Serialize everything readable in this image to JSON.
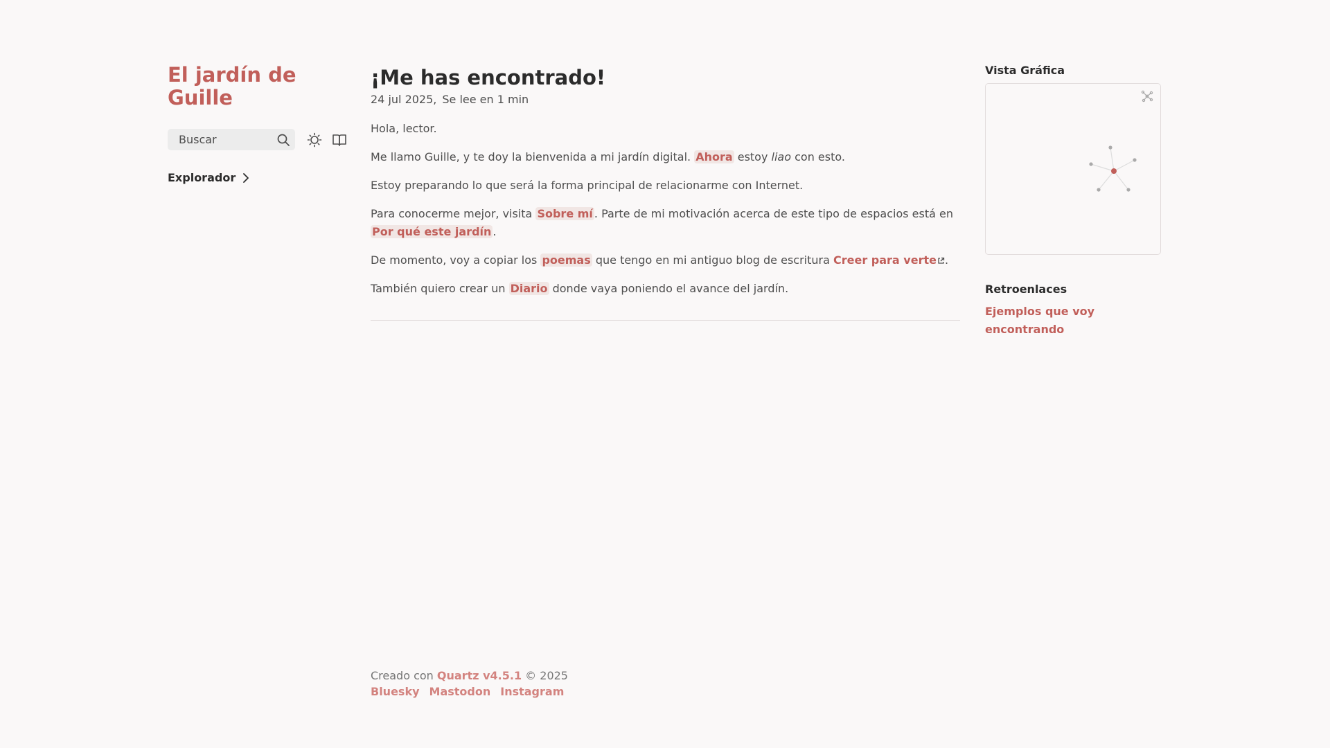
{
  "site": {
    "title": "El jardín de Guille"
  },
  "search": {
    "label": "Buscar"
  },
  "explorer": {
    "label": "Explorador"
  },
  "article": {
    "title": "¡Me has encontrado!",
    "date": "24 jul 2025,",
    "reading_time": "Se lee en 1 min",
    "p1": "Hola, lector.",
    "p2": {
      "before": "Me llamo Guille, y te doy la bienvenida a mi jardín digital. ",
      "link": "Ahora",
      "middle": " estoy ",
      "em": "liao",
      "after": " con esto."
    },
    "p3": "Estoy preparando lo que será la forma principal de relacionarme con Internet.",
    "p4": {
      "before": "Para conocerme mejor, visita ",
      "link1": "Sobre mí",
      "middle": ". Parte de mi motivación acerca de este tipo de espacios está en ",
      "link2": "Por qué este jardín",
      "after": "."
    },
    "p5": {
      "before": "De momento, voy a copiar los ",
      "link1": "poemas",
      "middle": " que tengo en mi antiguo blog de escritura ",
      "link2": "Creer para verte",
      "after": "."
    },
    "p6": {
      "before": "También quiero crear un ",
      "link": "Diario",
      "after": " donde vaya poniendo el avance del jardín."
    }
  },
  "graph": {
    "heading": "Vista Gráfica",
    "accent": "#c15f5a",
    "node_color": "#aaaaaa"
  },
  "backlinks": {
    "heading": "Retroenlaces",
    "items": [
      "Ejemplos que voy encontrando"
    ]
  },
  "footer": {
    "created_with": "Creado con ",
    "quartz": "Quartz v4.5.1",
    "copyright": " © 2025",
    "links": [
      "Bluesky",
      "Mastodon",
      "Instagram"
    ]
  }
}
